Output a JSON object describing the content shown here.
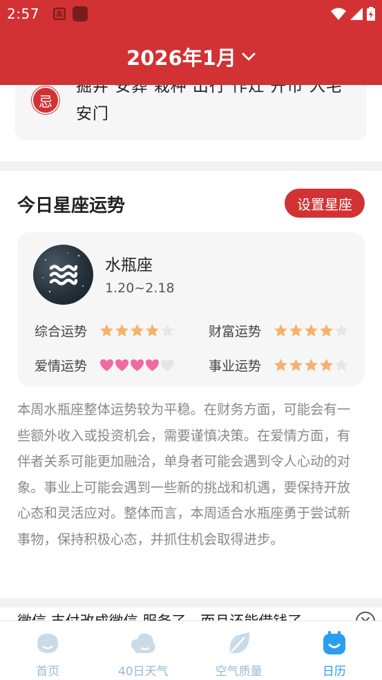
{
  "status_bar": {
    "time": "2:57",
    "a_icon": "A"
  },
  "header": {
    "title": "2026年1月"
  },
  "almanac": {
    "ji_label": "忌",
    "ji_items": "掘井 安葬 栽种 出行 作灶 开市 入宅 安门"
  },
  "horoscope": {
    "section_title": "今日星座运势",
    "set_button": "设置星座",
    "sign_name": "水瓶座",
    "sign_dates": "1.20~2.18",
    "fortunes": [
      {
        "label": "综合运势",
        "type": "star",
        "rating": 4,
        "max": 5
      },
      {
        "label": "财富运势",
        "type": "star",
        "rating": 4,
        "max": 5
      },
      {
        "label": "爱情运势",
        "type": "heart",
        "rating": 4,
        "max": 5
      },
      {
        "label": "事业运势",
        "type": "star",
        "rating": 4,
        "max": 5
      }
    ],
    "description": "本周水瓶座整体运势较为平稳。在财务方面，可能会有一些额外收入或投资机会，需要谨慎决策。在爱情方面，有伴者关系可能更加融洽，单身者可能会遇到令人心动的对象。事业上可能会遇到一些新的挑战和机遇，要保持开放心态和灵活应对。整体而言，本周适合水瓶座勇于尝试新事物，保持积极心态，并抓住机会取得进步。"
  },
  "article": {
    "title": "微信 支付改成微信 服务了，而且还能借钱了"
  },
  "nav": {
    "items": [
      {
        "label": "首页",
        "icon": "home-icon",
        "active": false
      },
      {
        "label": "40日天气",
        "icon": "weather-icon",
        "active": false
      },
      {
        "label": "空气质量",
        "icon": "leaf-icon",
        "active": false
      },
      {
        "label": "日历",
        "icon": "calendar-icon",
        "active": true
      }
    ]
  },
  "colors": {
    "brand_red": "#d23234",
    "star_filled": "#f5b26b",
    "heart_filled": "#f06aa0",
    "empty": "#e6e6e6",
    "nav_active": "#2a9ff0",
    "nav_inactive": "#9bb9d0"
  }
}
